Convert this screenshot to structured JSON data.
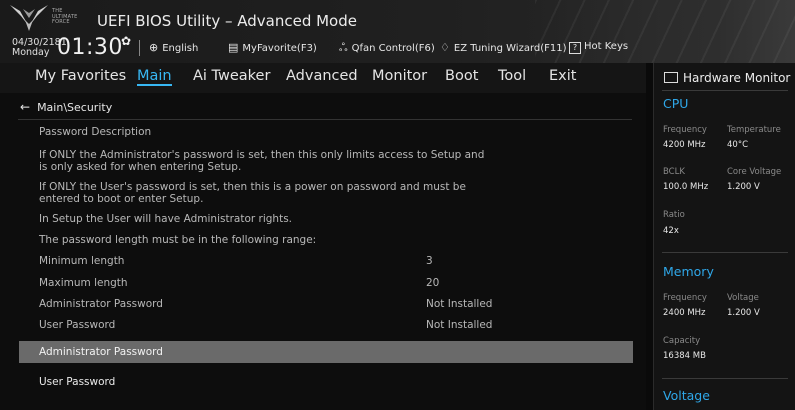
{
  "header": {
    "logo_text": "THE ULTIMATE FORCE",
    "title": "UEFI BIOS Utility – Advanced Mode",
    "date": "04/30/2181",
    "day": "Monday",
    "time": "01:30",
    "links": [
      {
        "icon": "globe-icon",
        "label": "English"
      },
      {
        "icon": "favorite-list-icon",
        "label": "MyFavorite(F3)"
      },
      {
        "icon": "fan-icon",
        "label": "Qfan Control(F6)"
      },
      {
        "icon": "bulb-icon",
        "label": "EZ Tuning Wizard(F11)"
      },
      {
        "icon": "help-icon",
        "label": "Hot Keys"
      }
    ]
  },
  "nav": {
    "tabs": [
      "My Favorites",
      "Main",
      "Ai Tweaker",
      "Advanced",
      "Monitor",
      "Boot",
      "Tool",
      "Exit"
    ],
    "active": "Main"
  },
  "main": {
    "breadcrumb": "Main\\Security",
    "description": [
      "Password Description",
      "If ONLY the Administrator's password is set, then this only limits access to Setup and",
      "is only asked for when entering Setup.",
      "If ONLY the User's password is set, then this is a power on password and must be",
      "entered to boot or enter Setup.",
      "In Setup the User will have Administrator rights.",
      "The password length must be in the following range:"
    ],
    "info": [
      {
        "label": "Minimum length",
        "value": "3"
      },
      {
        "label": "Maximum length",
        "value": "20"
      },
      {
        "label": "Administrator Password",
        "value": "Not Installed"
      },
      {
        "label": "User Password",
        "value": "Not Installed"
      }
    ],
    "items": [
      "Administrator Password",
      "User Password"
    ]
  },
  "hw": {
    "title": "Hardware Monitor",
    "cpu": {
      "heading": "CPU",
      "frequency_label": "Frequency",
      "frequency": "4200 MHz",
      "temperature_label": "Temperature",
      "temperature": "40°C",
      "bclk_label": "BCLK",
      "bclk": "100.0 MHz",
      "core_voltage_label": "Core Voltage",
      "core_voltage": "1.200 V",
      "ratio_label": "Ratio",
      "ratio": "42x"
    },
    "memory": {
      "heading": "Memory",
      "frequency_label": "Frequency",
      "frequency": "2400 MHz",
      "voltage_label": "Voltage",
      "voltage": "1.200 V",
      "capacity_label": "Capacity",
      "capacity": "16384 MB"
    },
    "voltage": {
      "heading": "Voltage"
    }
  },
  "colors": {
    "accent": "#38b7f3",
    "section": "#2fa7e8",
    "selected_row": "#6a6a6a"
  }
}
